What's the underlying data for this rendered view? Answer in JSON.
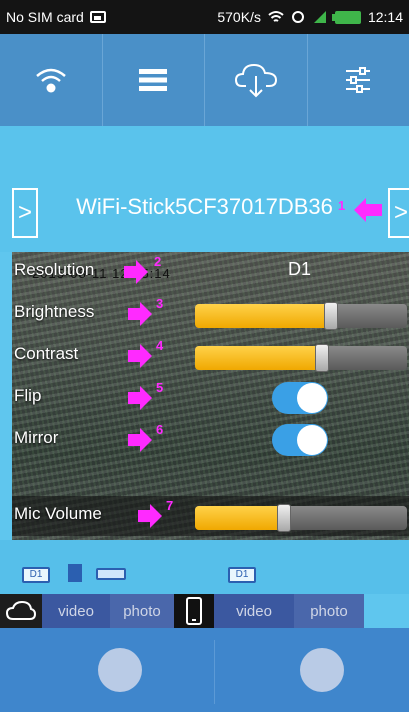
{
  "status_bar": {
    "carrier": "No SIM card",
    "speed": "570K/s",
    "time": "12:14"
  },
  "toolbar": {
    "buttons": [
      "wifi-connect-icon",
      "device-list-icon",
      "cloud-download-icon",
      "settings-sliders-icon"
    ]
  },
  "device": {
    "name": "WiFi-Stick5CF37017DB36",
    "callout": "1",
    "prev_arrow": ">",
    "next_arrow": ">"
  },
  "settings": {
    "timestamp": "2015-08-11 12:15:14",
    "rows": [
      {
        "label": "Resolution",
        "callout": "2",
        "value": "D1"
      },
      {
        "label": "Brightness",
        "callout": "3",
        "level": 0.64
      },
      {
        "label": "Contrast",
        "callout": "4",
        "level": 0.6
      },
      {
        "label": "Flip",
        "callout": "5",
        "on": true
      },
      {
        "label": "Mirror",
        "callout": "6",
        "on": true
      },
      {
        "label": "Mic Volume",
        "callout": "7",
        "level": 0.42
      }
    ]
  },
  "info_strip": {
    "left_badge": "D1",
    "right_badge": "D1"
  },
  "tabs": {
    "video_left": "video",
    "photo_left": "photo",
    "video_right": "video",
    "photo_right": "photo"
  },
  "colors": {
    "accent": "#5ac3ec",
    "toolbar": "#4a90c8",
    "callout_arrow": "#ff2aff",
    "slider_fill": "#f5b400",
    "toggle_on": "#3aa0e6"
  }
}
